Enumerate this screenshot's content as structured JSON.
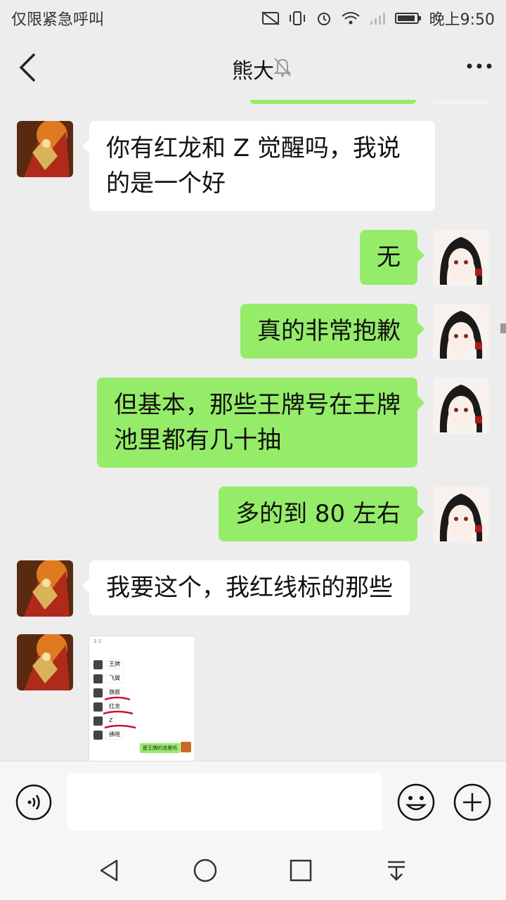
{
  "status_bar": {
    "carrier_text": "仅限紧急呼叫",
    "time": "晚上9:50",
    "icons": [
      "no-sim-icon",
      "vibrate-icon",
      "alarm-icon",
      "wifi-icon",
      "signal-icon",
      "battery-icon"
    ]
  },
  "header": {
    "title": "熊大",
    "muted": true,
    "icons": [
      "back-icon",
      "mute-bell-icon",
      "more-icon"
    ]
  },
  "messages": [
    {
      "from": "friend",
      "text_line1": "你有红龙和 Z 觉醒吗，我说",
      "text_line2": "的是一个好"
    },
    {
      "from": "me",
      "text": "无"
    },
    {
      "from": "me",
      "text": "真的非常抱歉"
    },
    {
      "from": "me",
      "text_line1": "但基本，那些王牌号在王牌",
      "text_line2": "池里都有几十抽"
    },
    {
      "from": "me",
      "text": "多的到 80 左右"
    },
    {
      "from": "friend",
      "text": "我要这个，我红线标的那些"
    },
    {
      "from": "friend",
      "type": "image",
      "image": {
        "time": "1:1",
        "names": [
          "王牌",
          "飞翼",
          "旗舰",
          "红龙",
          "Z",
          "拂晓"
        ],
        "reply": "是王牌的池里吗"
      }
    }
  ],
  "input_bar": {
    "icons": [
      "voice-icon",
      "emoji-icon",
      "plus-icon"
    ],
    "value": ""
  },
  "nav_bar": {
    "icons": [
      "back-triangle-icon",
      "home-circle-icon",
      "recents-square-icon",
      "notification-pull-icon"
    ]
  },
  "colors": {
    "background": "#ededed",
    "my_bubble": "#95ec69",
    "friend_bubble": "#ffffff"
  }
}
